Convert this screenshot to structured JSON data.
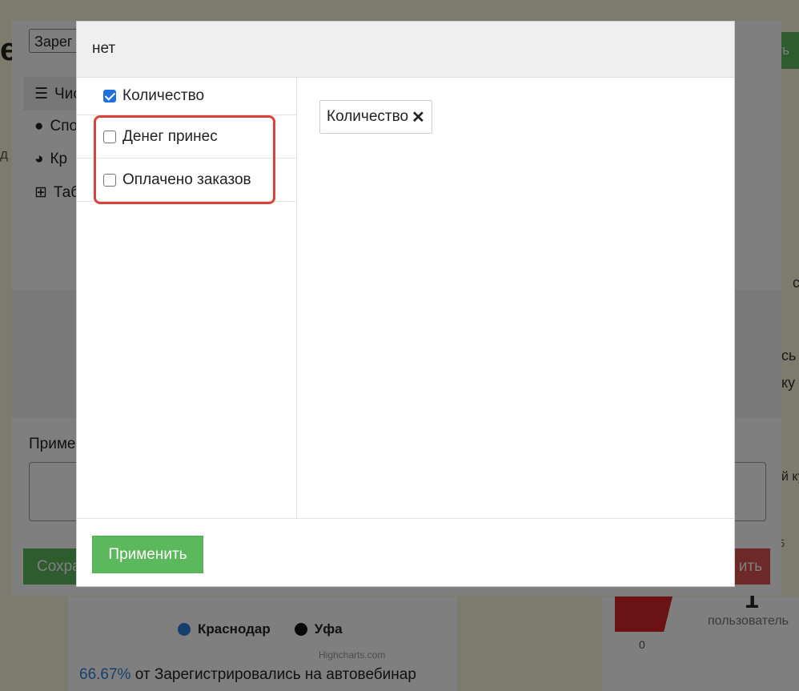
{
  "background": {
    "legend": [
      {
        "label": "Краснодар",
        "color": "#2f7ed8"
      },
      {
        "label": "Уфа",
        "color": "#111111"
      }
    ],
    "credit": "Highcharts.com",
    "percent_value": "66.67%",
    "percent_text": " от Зарегистрировались на автовебинар",
    "gauge_value": "1",
    "gauge_unit": "пользователь",
    "gauge_min": "0",
    "gauge_tick": "5",
    "partial_heading": "е",
    "partial_od": "д",
    "top_button_partial": "ить",
    "right_frag_1": "сь",
    "right_frag_2": "ку",
    "right_frag_3": "й ку",
    "right_frag_4": "с"
  },
  "editor": {
    "top_input_value": "Зарег",
    "menu": [
      {
        "icon": "list-icon",
        "label": "Чис"
      },
      {
        "icon": "palette-icon",
        "label": "Спо"
      },
      {
        "icon": "pie-chart-icon",
        "label": "Кр"
      },
      {
        "icon": "table-icon",
        "label": "Таб"
      }
    ],
    "note_label": "Приме",
    "save_label": "Сохра",
    "delete_label": "ить"
  },
  "modal": {
    "title": "нет",
    "options": [
      {
        "label": "Количество",
        "checked": true
      },
      {
        "label": "Денег принес",
        "checked": false
      },
      {
        "label": "Оплачено заказов",
        "checked": false
      }
    ],
    "selected_tags": [
      {
        "label": "Количество",
        "remove": "✕"
      }
    ],
    "apply_label": "Применить"
  },
  "colors": {
    "primary_green": "#5cb85c",
    "danger_red": "#d9534f",
    "highlight_red": "#d8433a",
    "checkbox_blue": "#1e6fe0"
  }
}
